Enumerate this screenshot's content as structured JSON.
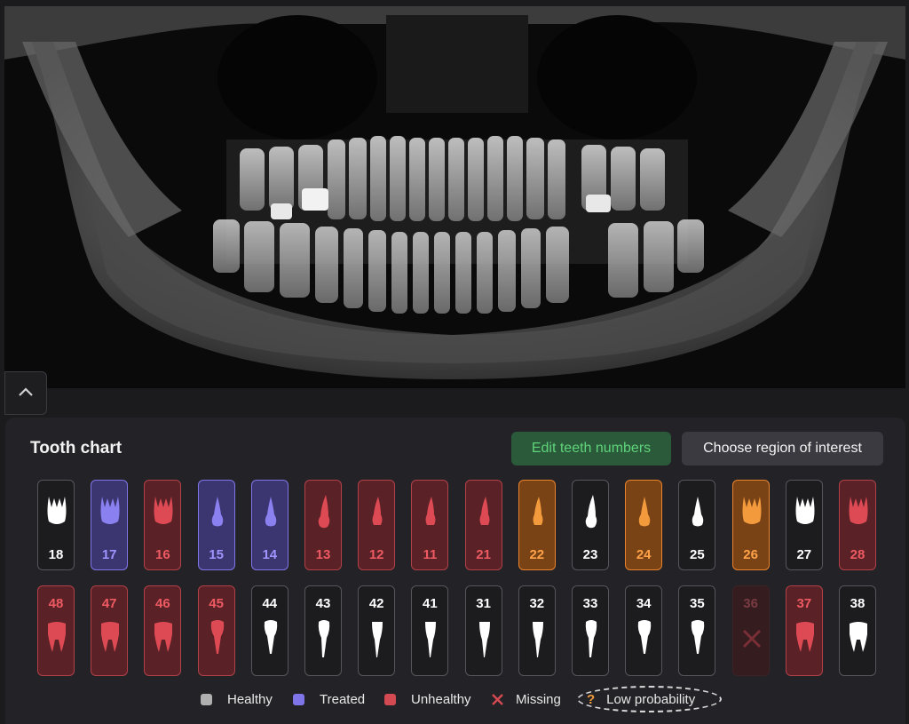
{
  "panel": {
    "title": "Tooth chart",
    "edit_button": "Edit teeth numbers",
    "roi_button": "Choose region of interest"
  },
  "colors": {
    "healthy": "#b0b0b0",
    "treated": "#8075e8",
    "unhealthy": "#d44a52",
    "low_probability": "#f29a3c",
    "missing": "#d44a52"
  },
  "upper_teeth": [
    {
      "number": "18",
      "status": "healthy",
      "shape": "molar"
    },
    {
      "number": "17",
      "status": "treated",
      "shape": "molar"
    },
    {
      "number": "16",
      "status": "unhealthy",
      "shape": "molar"
    },
    {
      "number": "15",
      "status": "treated",
      "shape": "premolar"
    },
    {
      "number": "14",
      "status": "treated",
      "shape": "premolar"
    },
    {
      "number": "13",
      "status": "unhealthy",
      "shape": "canine"
    },
    {
      "number": "12",
      "status": "unhealthy",
      "shape": "incisor"
    },
    {
      "number": "11",
      "status": "unhealthy",
      "shape": "incisor"
    },
    {
      "number": "21",
      "status": "unhealthy",
      "shape": "incisor"
    },
    {
      "number": "22",
      "status": "low",
      "shape": "incisor"
    },
    {
      "number": "23",
      "status": "healthy",
      "shape": "canine"
    },
    {
      "number": "24",
      "status": "low",
      "shape": "premolar"
    },
    {
      "number": "25",
      "status": "healthy",
      "shape": "premolar"
    },
    {
      "number": "26",
      "status": "low",
      "shape": "molar"
    },
    {
      "number": "27",
      "status": "healthy",
      "shape": "molar"
    },
    {
      "number": "28",
      "status": "unhealthy",
      "shape": "molar"
    }
  ],
  "lower_teeth": [
    {
      "number": "48",
      "status": "unhealthy",
      "shape": "molar"
    },
    {
      "number": "47",
      "status": "unhealthy",
      "shape": "molar"
    },
    {
      "number": "46",
      "status": "unhealthy",
      "shape": "molar"
    },
    {
      "number": "45",
      "status": "unhealthy",
      "shape": "premolar"
    },
    {
      "number": "44",
      "status": "healthy",
      "shape": "premolar"
    },
    {
      "number": "43",
      "status": "healthy",
      "shape": "canine"
    },
    {
      "number": "42",
      "status": "healthy",
      "shape": "incisor"
    },
    {
      "number": "41",
      "status": "healthy",
      "shape": "incisor"
    },
    {
      "number": "31",
      "status": "healthy",
      "shape": "incisor"
    },
    {
      "number": "32",
      "status": "healthy",
      "shape": "incisor"
    },
    {
      "number": "33",
      "status": "healthy",
      "shape": "canine"
    },
    {
      "number": "34",
      "status": "healthy",
      "shape": "premolar"
    },
    {
      "number": "35",
      "status": "healthy",
      "shape": "premolar"
    },
    {
      "number": "36",
      "status": "missing",
      "shape": "missing"
    },
    {
      "number": "37",
      "status": "unhealthy",
      "shape": "molar"
    },
    {
      "number": "38",
      "status": "healthy",
      "shape": "molar"
    }
  ],
  "legend": {
    "healthy": "Healthy",
    "treated": "Treated",
    "unhealthy": "Unhealthy",
    "missing": "Missing",
    "low_probability": "Low probability"
  },
  "icons": {
    "collapse": "chevron-up-icon",
    "missing": "x-icon",
    "low_probability": "question-mark-icon"
  }
}
